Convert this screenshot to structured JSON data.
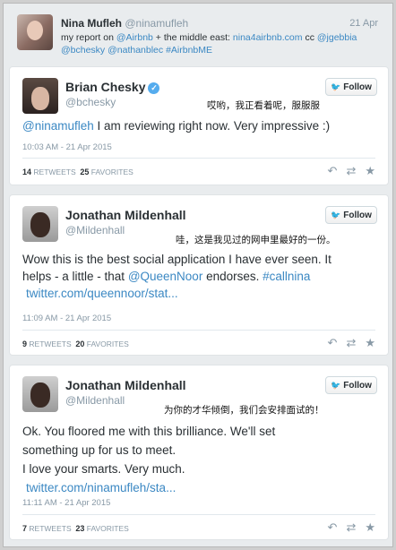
{
  "top_tweet": {
    "name": "Nina Mufleh",
    "handle": "@ninamufleh",
    "date": "21 Apr",
    "text_1": "my report on ",
    "mention_airbnb": "@Airbnb",
    "text_2": " + the middle east: ",
    "link": "nina4airbnb.com",
    "text_3": " cc ",
    "mention_jgebbia": "@jgebbia",
    "mention_bchesky": "@bchesky",
    "mention_nathan": "@nathanblec",
    "hashtag": "#AirbnbME"
  },
  "follow_label": "Follow",
  "tweets": [
    {
      "name": "Brian Chesky",
      "handle": "@bchesky",
      "annotation": "哎哟，我正看着呢，服服服",
      "mention": "@ninamufleh",
      "body": " I am reviewing right now. Very impressive :)",
      "timestamp": "10:03 AM - 21 Apr 2015",
      "retweets": "14",
      "retweets_label": "RETWEETS",
      "favorites": "25",
      "favorites_label": "FAVORITES"
    },
    {
      "name": "Jonathan Mildenhall",
      "handle": "@Mildenhall",
      "annotation": "哇，这是我见过的网申里最好的一份。",
      "line_1": "Wow this is the best social application I have ever seen. It",
      "line_2a": "helps - a little - that ",
      "mention": "@QueenNoor",
      "line_2b": " endorses. ",
      "hashtag": "#callnina",
      "link": "twitter.com/queennoor/stat...",
      "timestamp": "11:09 AM - 21 Apr 2015",
      "retweets": "9",
      "retweets_label": "RETWEETS",
      "favorites": "20",
      "favorites_label": "FAVORITES"
    },
    {
      "name": "Jonathan Mildenhall",
      "handle": "@Mildenhall",
      "annotation": "为你的才华倾倒，我们会安排面试的！",
      "line_1": "Ok. You floored me with this brilliance. We'll set",
      "line_2": "something up for us to meet.",
      "line_3": "I love your smarts. Very much.",
      "link": "twitter.com/ninamufleh/sta...",
      "timestamp": "11:11 AM - 21 Apr 2015",
      "retweets": "7",
      "retweets_label": "RETWEETS",
      "favorites": "23",
      "favorites_label": "FAVORITES"
    }
  ],
  "icons": {
    "reply": "reply-icon",
    "retweet": "retweet-icon",
    "favorite": "star-icon",
    "verified": "verified-badge-icon",
    "follow_bird": "twitter-bird-icon"
  },
  "colors": {
    "link": "#3b88c3",
    "verified": "#55acee",
    "muted": "#8899a6"
  }
}
